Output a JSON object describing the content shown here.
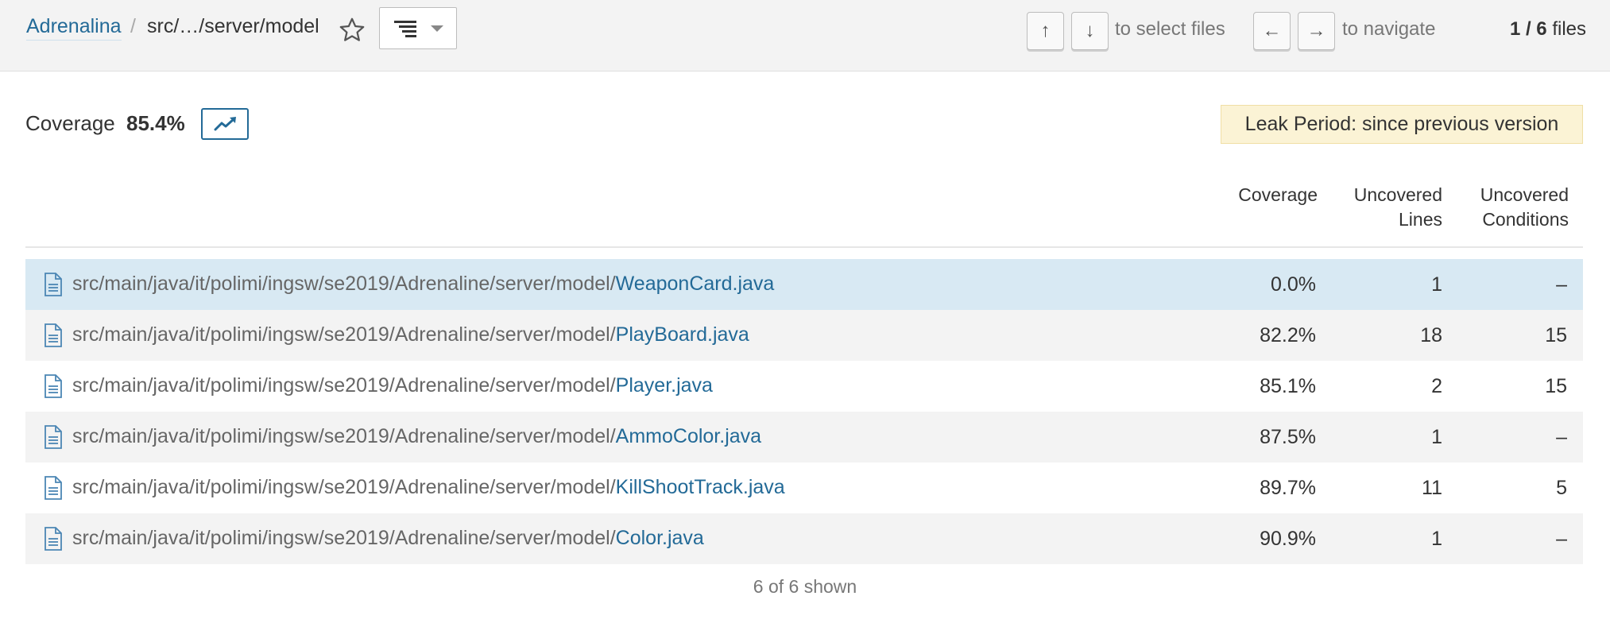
{
  "breadcrumb": {
    "project": "Adrenalina",
    "separator": "/",
    "path": "src/…/server/model"
  },
  "toolbar": {
    "favorite_icon": "star-outline-icon",
    "view_icon": "list-tree-icon"
  },
  "keyboard": {
    "up": "↑",
    "down": "↓",
    "select_hint": "to select files",
    "left": "←",
    "right": "→",
    "navigate_hint": "to navigate"
  },
  "file_count": {
    "current": "1 / 6",
    "suffix": "files"
  },
  "summary": {
    "metric_label": "Coverage",
    "metric_value": "85.4%",
    "history_icon": "trend-chart-icon"
  },
  "leak_period": "Leak Period: since previous version",
  "table": {
    "headers": {
      "coverage": "Coverage",
      "uncovered_lines_1": "Uncovered",
      "uncovered_lines_2": "Lines",
      "uncovered_conditions_1": "Uncovered",
      "uncovered_conditions_2": "Conditions"
    },
    "rows": [
      {
        "dir": "src/main/java/it/polimi/ingsw/se2019/Adrenaline/server/model/",
        "name": "WeaponCard.java",
        "coverage": "0.0%",
        "uncovered_lines": "1",
        "uncovered_conditions": "–"
      },
      {
        "dir": "src/main/java/it/polimi/ingsw/se2019/Adrenaline/server/model/",
        "name": "PlayBoard.java",
        "coverage": "82.2%",
        "uncovered_lines": "18",
        "uncovered_conditions": "15"
      },
      {
        "dir": "src/main/java/it/polimi/ingsw/se2019/Adrenaline/server/model/",
        "name": "Player.java",
        "coverage": "85.1%",
        "uncovered_lines": "2",
        "uncovered_conditions": "15"
      },
      {
        "dir": "src/main/java/it/polimi/ingsw/se2019/Adrenaline/server/model/",
        "name": "AmmoColor.java",
        "coverage": "87.5%",
        "uncovered_lines": "1",
        "uncovered_conditions": "–"
      },
      {
        "dir": "src/main/java/it/polimi/ingsw/se2019/Adrenaline/server/model/",
        "name": "KillShootTrack.java",
        "coverage": "89.7%",
        "uncovered_lines": "11",
        "uncovered_conditions": "5"
      },
      {
        "dir": "src/main/java/it/polimi/ingsw/se2019/Adrenaline/server/model/",
        "name": "Color.java",
        "coverage": "90.9%",
        "uncovered_lines": "1",
        "uncovered_conditions": "–"
      }
    ],
    "footer": "6 of 6 shown"
  },
  "colors": {
    "link": "#236a97",
    "selected_row": "#d8e9f3",
    "leak_background": "#fbf3d5"
  }
}
